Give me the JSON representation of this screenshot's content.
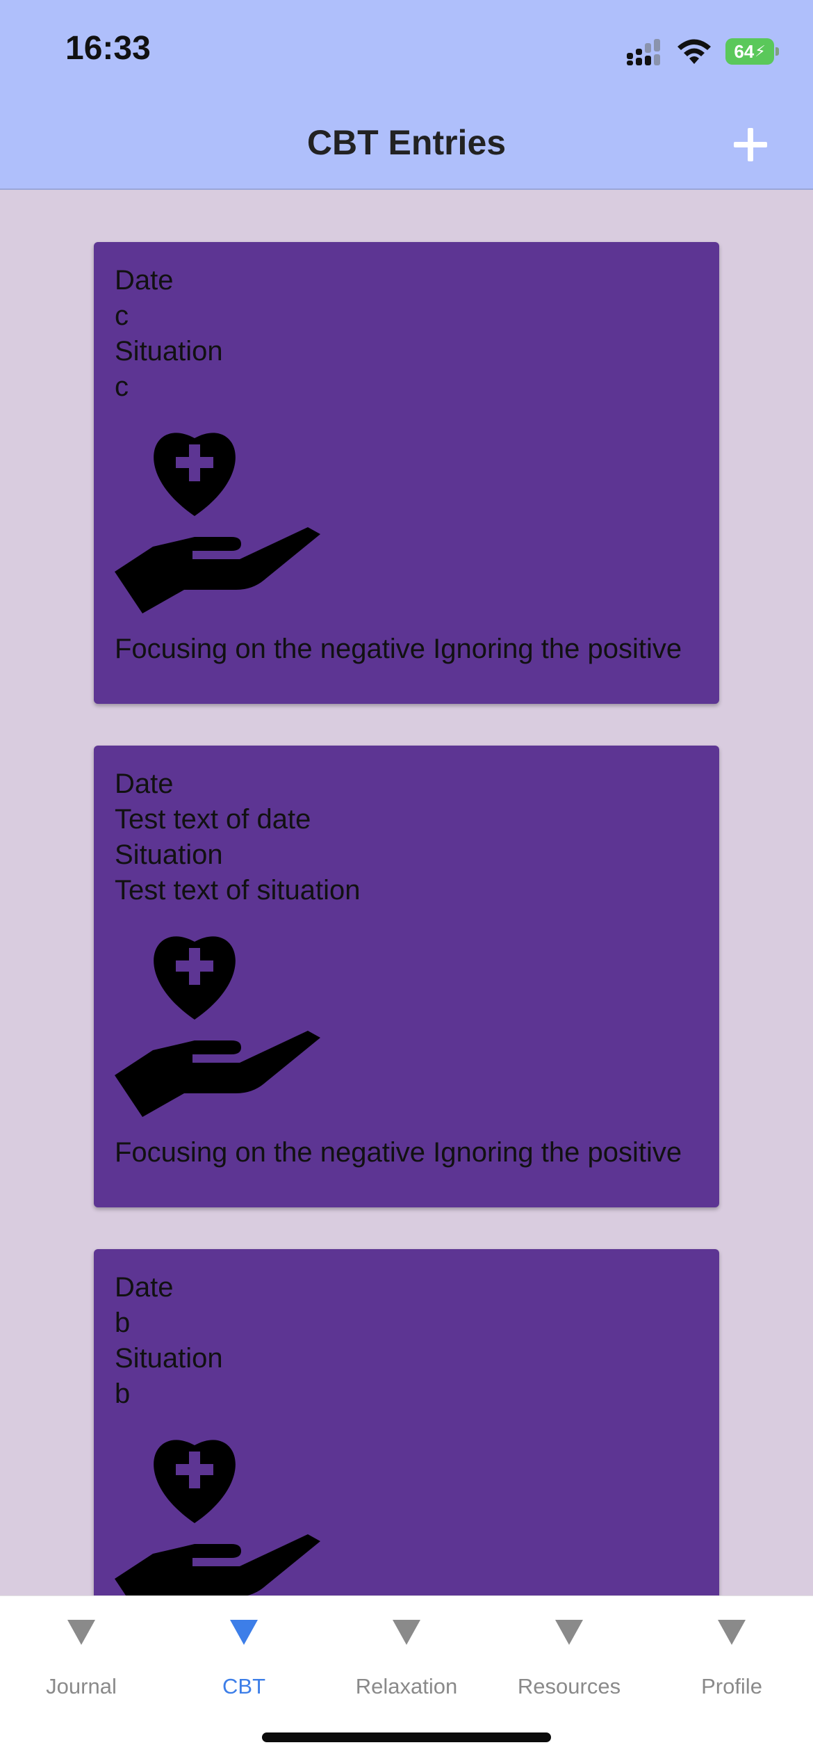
{
  "status_bar": {
    "time": "16:33",
    "battery": "64"
  },
  "header": {
    "title": "CBT Entries"
  },
  "entries": [
    {
      "date_label": "Date",
      "date": "c",
      "situation_label": "Situation",
      "situation": "c",
      "icon": "heart-hand-icon",
      "bias": "Focusing on the negative Ignoring the positive"
    },
    {
      "date_label": "Date",
      "date": "Test text of date",
      "situation_label": "Situation",
      "situation": "Test text of situation",
      "icon": "heart-hand-icon",
      "bias": "Focusing on the negative Ignoring the positive"
    },
    {
      "date_label": "Date",
      "date": "b",
      "situation_label": "Situation",
      "situation": "b",
      "icon": "heart-hand-icon",
      "bias": ""
    }
  ],
  "tabs": [
    {
      "label": "Journal",
      "active": false
    },
    {
      "label": "CBT",
      "active": true
    },
    {
      "label": "Relaxation",
      "active": false
    },
    {
      "label": "Resources",
      "active": false
    },
    {
      "label": "Profile",
      "active": false
    }
  ],
  "colors": {
    "header_bg": "#afbffb",
    "page_bg": "#d9ccdf",
    "card_bg": "#5d3593",
    "tab_active": "#3d7ee8",
    "tab_inactive": "#8a8a8a",
    "battery": "#5ac85a"
  }
}
